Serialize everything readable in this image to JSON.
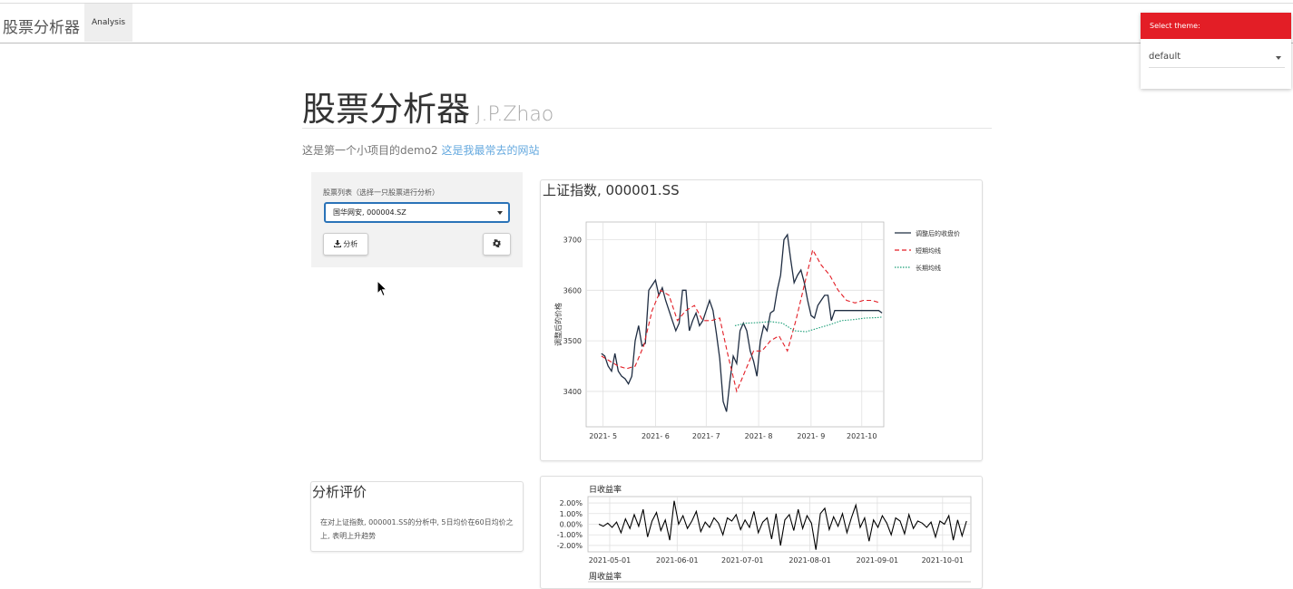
{
  "navbar": {
    "brand": "股票分析器",
    "tab_label": "Analysis"
  },
  "theme_selector": {
    "heading": "Select theme:",
    "value": "default"
  },
  "header": {
    "title": "股票分析器",
    "author": "J.P.Zhao",
    "subtitle_prefix": "这是第一个小项目的demo2",
    "link_text": "这是我最常去的网站"
  },
  "sidebar": {
    "label": "股票列表（选择一只股票进行分析）",
    "selected_stock": "国华网安, 000004.SZ",
    "analyze_label": "分析"
  },
  "main_chart": {
    "heading": "上证指数, 000001.SS"
  },
  "evaluation": {
    "heading": "分析评价",
    "text": "在对上证指数, 000001.SS的分析中, 5日均价在60日均价之上, 表明上升趋势"
  },
  "chart_data": [
    {
      "type": "line",
      "ylabel": "调整后的价格",
      "xlim": [
        "2021-04-21",
        "2021-10-14"
      ],
      "ylim": [
        3330,
        3735
      ],
      "y_ticks": [
        3400,
        3500,
        3600,
        3700
      ],
      "x_ticks": [
        "2021- 5",
        "2021- 6",
        "2021- 7",
        "2021- 8",
        "2021- 9",
        "2021-10"
      ],
      "x_tick_dates": [
        "2021-05-01",
        "2021-06-01",
        "2021-07-01",
        "2021-08-01",
        "2021-09-01",
        "2021-10-01"
      ],
      "grid": true,
      "legend_position": "right",
      "series": [
        {
          "name": "调整后的收盘价",
          "color": "#1f2d42",
          "style": "solid",
          "x": [
            "2021-04-30",
            "2021-05-02",
            "2021-05-04",
            "2021-05-06",
            "2021-05-08",
            "2021-05-10",
            "2021-05-12",
            "2021-05-14",
            "2021-05-16",
            "2021-05-18",
            "2021-05-20",
            "2021-05-22",
            "2021-05-24",
            "2021-05-26",
            "2021-05-28",
            "2021-05-30",
            "2021-06-01",
            "2021-06-03",
            "2021-06-05",
            "2021-06-07",
            "2021-06-09",
            "2021-06-11",
            "2021-06-13",
            "2021-06-15",
            "2021-06-17",
            "2021-06-19",
            "2021-06-21",
            "2021-06-23",
            "2021-06-25",
            "2021-06-27",
            "2021-06-29",
            "2021-07-01",
            "2021-07-03",
            "2021-07-05",
            "2021-07-07",
            "2021-07-09",
            "2021-07-11",
            "2021-07-13",
            "2021-07-15",
            "2021-07-17",
            "2021-07-19",
            "2021-07-21",
            "2021-07-23",
            "2021-07-25",
            "2021-07-27",
            "2021-07-29",
            "2021-07-31",
            "2021-08-02",
            "2021-08-04",
            "2021-08-06",
            "2021-08-08",
            "2021-08-10",
            "2021-08-12",
            "2021-08-14",
            "2021-08-16",
            "2021-08-18",
            "2021-08-20",
            "2021-08-22",
            "2021-08-24",
            "2021-08-26",
            "2021-08-28",
            "2021-08-30",
            "2021-09-01",
            "2021-09-03",
            "2021-09-05",
            "2021-09-07",
            "2021-09-09",
            "2021-09-11",
            "2021-09-13",
            "2021-09-15",
            "2021-09-17",
            "2021-09-19",
            "2021-09-21",
            "2021-09-23",
            "2021-09-25",
            "2021-09-27",
            "2021-09-29",
            "2021-10-01",
            "2021-10-03",
            "2021-10-05",
            "2021-10-07",
            "2021-10-09",
            "2021-10-11",
            "2021-10-13"
          ],
          "y": [
            3475,
            3470,
            3450,
            3440,
            3475,
            3440,
            3430,
            3425,
            3415,
            3430,
            3500,
            3530,
            3490,
            3495,
            3600,
            3610,
            3620,
            3590,
            3605,
            3580,
            3560,
            3540,
            3520,
            3535,
            3600,
            3600,
            3520,
            3540,
            3555,
            3530,
            3540,
            3560,
            3580,
            3560,
            3515,
            3465,
            3380,
            3360,
            3420,
            3470,
            3455,
            3520,
            3535,
            3520,
            3480,
            3460,
            3430,
            3500,
            3530,
            3520,
            3555,
            3560,
            3600,
            3630,
            3700,
            3710,
            3660,
            3615,
            3630,
            3640,
            3615,
            3580,
            3550,
            3545,
            3570,
            3580,
            3590,
            3590,
            3540,
            3560,
            3560,
            3560,
            3560,
            3560,
            3560,
            3560,
            3560,
            3560,
            3560,
            3560,
            3560,
            3560,
            3560,
            3555
          ]
        },
        {
          "name": "短期均线",
          "color": "#e31e26",
          "style": "dashed",
          "x": [
            "2021-04-30",
            "2021-05-05",
            "2021-05-10",
            "2021-05-15",
            "2021-05-20",
            "2021-05-25",
            "2021-05-30",
            "2021-06-04",
            "2021-06-09",
            "2021-06-14",
            "2021-06-19",
            "2021-06-24",
            "2021-06-29",
            "2021-07-04",
            "2021-07-09",
            "2021-07-14",
            "2021-07-19",
            "2021-07-24",
            "2021-07-29",
            "2021-08-03",
            "2021-08-08",
            "2021-08-13",
            "2021-08-18",
            "2021-08-23",
            "2021-08-28",
            "2021-09-02",
            "2021-09-07",
            "2021-09-12",
            "2021-09-17",
            "2021-09-22",
            "2021-09-27",
            "2021-10-02",
            "2021-10-07",
            "2021-10-12"
          ],
          "y": [
            3470,
            3460,
            3450,
            3445,
            3450,
            3490,
            3560,
            3600,
            3590,
            3540,
            3560,
            3570,
            3540,
            3540,
            3545,
            3470,
            3400,
            3440,
            3480,
            3480,
            3500,
            3510,
            3480,
            3540,
            3610,
            3680,
            3650,
            3630,
            3600,
            3580,
            3575,
            3580,
            3580,
            3575
          ]
        },
        {
          "name": "长期均线",
          "color": "#1a9e77",
          "style": "dotted",
          "x": [
            "2021-07-18",
            "2021-07-25",
            "2021-08-01",
            "2021-08-08",
            "2021-08-15",
            "2021-08-22",
            "2021-08-29",
            "2021-09-05",
            "2021-09-12",
            "2021-09-19",
            "2021-09-26",
            "2021-10-03",
            "2021-10-10",
            "2021-10-13"
          ],
          "y": [
            3530,
            3535,
            3536,
            3538,
            3535,
            3520,
            3518,
            3525,
            3532,
            3540,
            3542,
            3545,
            3546,
            3547
          ]
        }
      ]
    },
    {
      "type": "line",
      "title": "日收益率",
      "xlim": [
        "2021-04-21",
        "2021-10-14"
      ],
      "ylim": [
        -0.026,
        0.026
      ],
      "y_ticks": [
        "2.00%",
        "1.00%",
        "0.00%",
        "-1.00%",
        "-2.00%"
      ],
      "y_tick_values": [
        0.02,
        0.01,
        0,
        -0.01,
        -0.02
      ],
      "x_ticks": [
        "2021-05-01",
        "2021-06-01",
        "2021-07-01",
        "2021-08-01",
        "2021-09-01",
        "2021-10-01"
      ],
      "grid": true,
      "series": [
        {
          "name": "",
          "color": "#000000",
          "style": "solid",
          "values": [
            0.0,
            -0.002,
            0.001,
            -0.003,
            0.002,
            -0.008,
            0.005,
            -0.004,
            0.009,
            -0.002,
            0.014,
            -0.012,
            0.003,
            0.011,
            -0.006,
            0.004,
            -0.015,
            0.022,
            0.0,
            0.008,
            -0.004,
            0.003,
            0.012,
            -0.007,
            0.002,
            -0.003,
            0.006,
            0.001,
            -0.01,
            0.006,
            0.003,
            0.009,
            -0.005,
            0.004,
            -0.003,
            0.012,
            -0.008,
            0.002,
            0.006,
            -0.014,
            0.01,
            -0.02,
            0.004,
            0.009,
            -0.006,
            0.014,
            -0.004,
            0.008,
            0.001,
            -0.024,
            0.01,
            0.015,
            -0.005,
            0.007,
            -0.002,
            0.01,
            -0.008,
            0.006,
            0.018,
            -0.003,
            0.006,
            -0.016,
            0.004,
            -0.003,
            0.008,
            0.001,
            -0.01,
            0.006,
            0.003,
            -0.009,
            0.009,
            -0.004,
            0.003,
            0.001,
            -0.003,
            0.002,
            -0.012,
            0.003,
            0.0,
            0.008,
            -0.015,
            0.004,
            -0.011,
            0.003
          ]
        }
      ]
    },
    {
      "type": "line",
      "title": "周收益率"
    }
  ]
}
